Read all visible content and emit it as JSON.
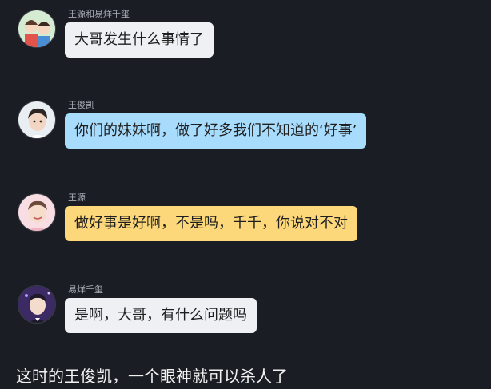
{
  "messages": [
    {
      "sender": "王源和易烊千玺",
      "text": "大哥发生什么事情了",
      "bubble_color": "#eef0f4",
      "avatar": "cartoon-duo-avatar-icon"
    },
    {
      "sender": "王俊凯",
      "text": "你们的妹妹啊，做了好多我们不知道的‘好事’",
      "bubble_color": "#a8dcfd",
      "avatar": "boy-portrait-avatar-icon"
    },
    {
      "sender": "王源",
      "text": "做好事是好啊，不是吗，千千，你说对不对",
      "bubble_color": "#fdd87b",
      "avatar": "boy-pink-avatar-icon"
    },
    {
      "sender": "易烊千玺",
      "text": "是啊，大哥，有什么问题吗",
      "bubble_color": "#eef0f4",
      "avatar": "boy-purple-avatar-icon"
    }
  ],
  "caption": "这时的王俊凯，一个眼神就可以杀人了"
}
